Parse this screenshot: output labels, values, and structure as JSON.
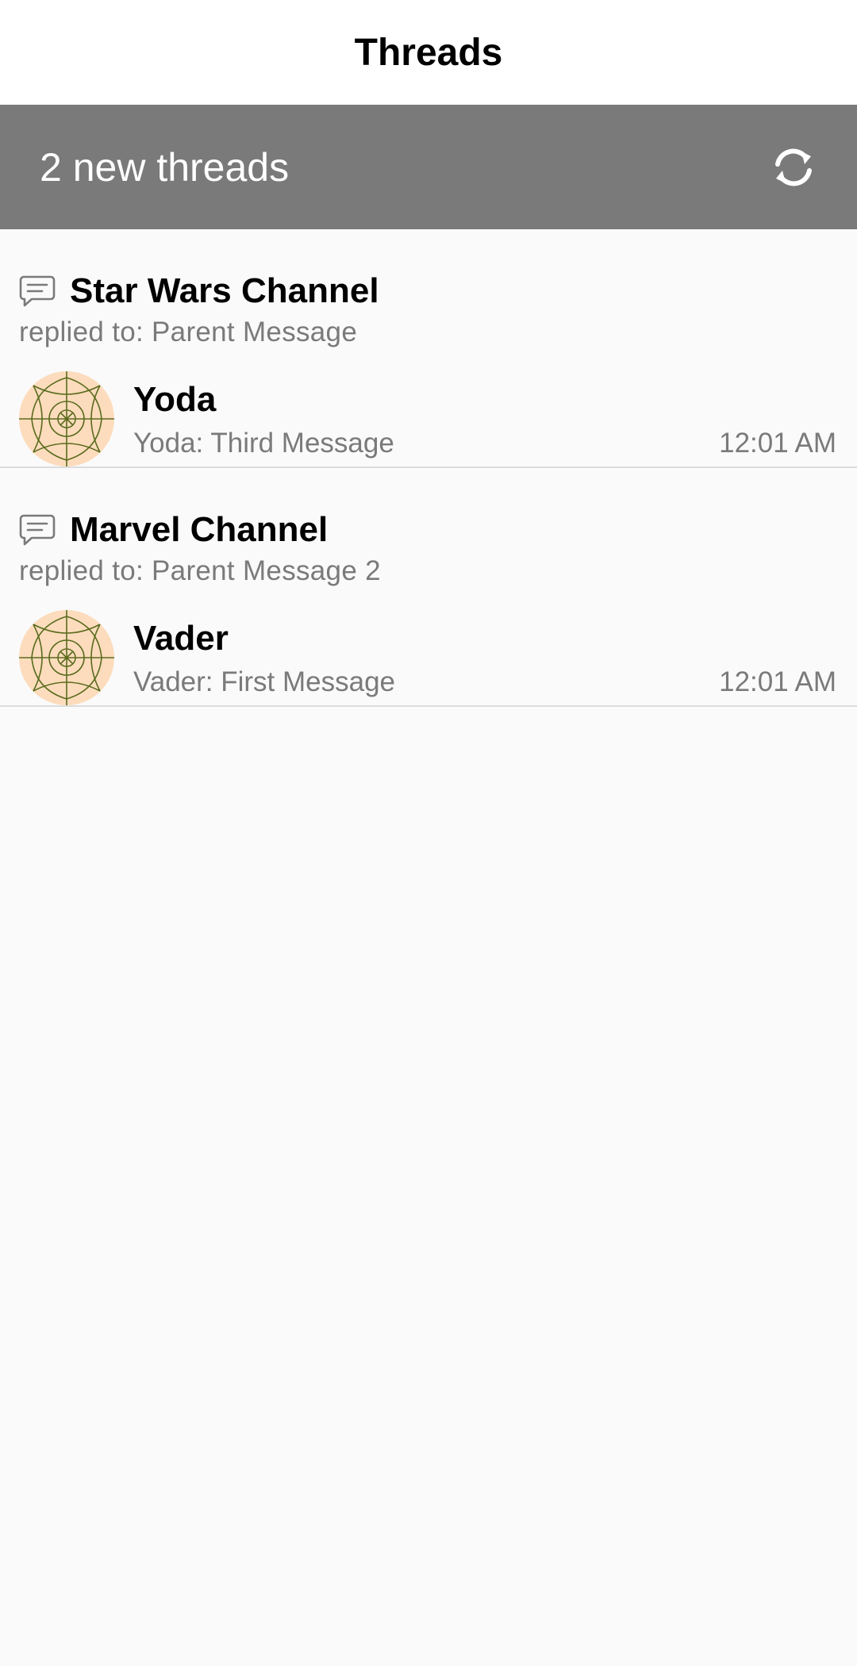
{
  "header": {
    "title": "Threads"
  },
  "banner": {
    "text": "2 new threads",
    "icon": "refresh-icon"
  },
  "threads": [
    {
      "channel": "Star Wars Channel",
      "replied_to": "replied to: Parent Message",
      "author": "Yoda",
      "last_message": "Yoda: Third Message",
      "time": "12:01 AM"
    },
    {
      "channel": "Marvel Channel",
      "replied_to": "replied to: Parent Message 2",
      "author": "Vader",
      "last_message": "Vader: First Message",
      "time": "12:01 AM"
    }
  ],
  "colors": {
    "banner_bg": "#7a7a7a",
    "avatar_bg": "#fcdcbc",
    "avatar_lines": "#5a6b1e",
    "secondary_text": "#7a7a7a"
  }
}
